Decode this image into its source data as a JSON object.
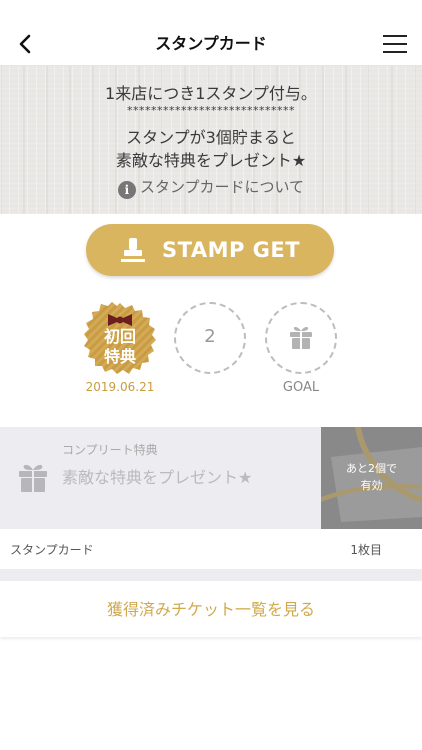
{
  "header": {
    "title": "スタンプカード",
    "back_icon": "chevron-left-icon",
    "menu_icon": "hamburger-menu-icon"
  },
  "banner": {
    "line1": "1来店につき1スタンプ付与。",
    "stars": "****************************",
    "line2": "スタンプが3個貯まると",
    "line3": "素敵な特典をプレゼント★",
    "about_link": "スタンプカードについて",
    "info_icon": "info-icon",
    "info_glyph": "i"
  },
  "stamp_button": {
    "label": "STAMP GET",
    "icon": "stamp-icon"
  },
  "stamps": {
    "first_badge_text_top": "初回",
    "first_badge_text_bottom": "特典",
    "first_date": "2019.06.21",
    "second_number": "2",
    "goal_label": "GOAL",
    "goal_icon": "gift-icon"
  },
  "complete": {
    "subtitle": "コンプリート特典",
    "title": "素敵な特典をプレゼント★",
    "icon": "gift-icon",
    "ticket_line1": "あと2個で",
    "ticket_line2": "有効"
  },
  "card_row": {
    "label": "スタンプカード",
    "count": "1枚目"
  },
  "ticket_list_link": "獲得済みチケット一覧を見る",
  "colors": {
    "accent_gold": "#d9b560",
    "link_gold": "#d1a94d",
    "date_gold": "#c79d3d",
    "panel_gray": "#ececf1"
  }
}
